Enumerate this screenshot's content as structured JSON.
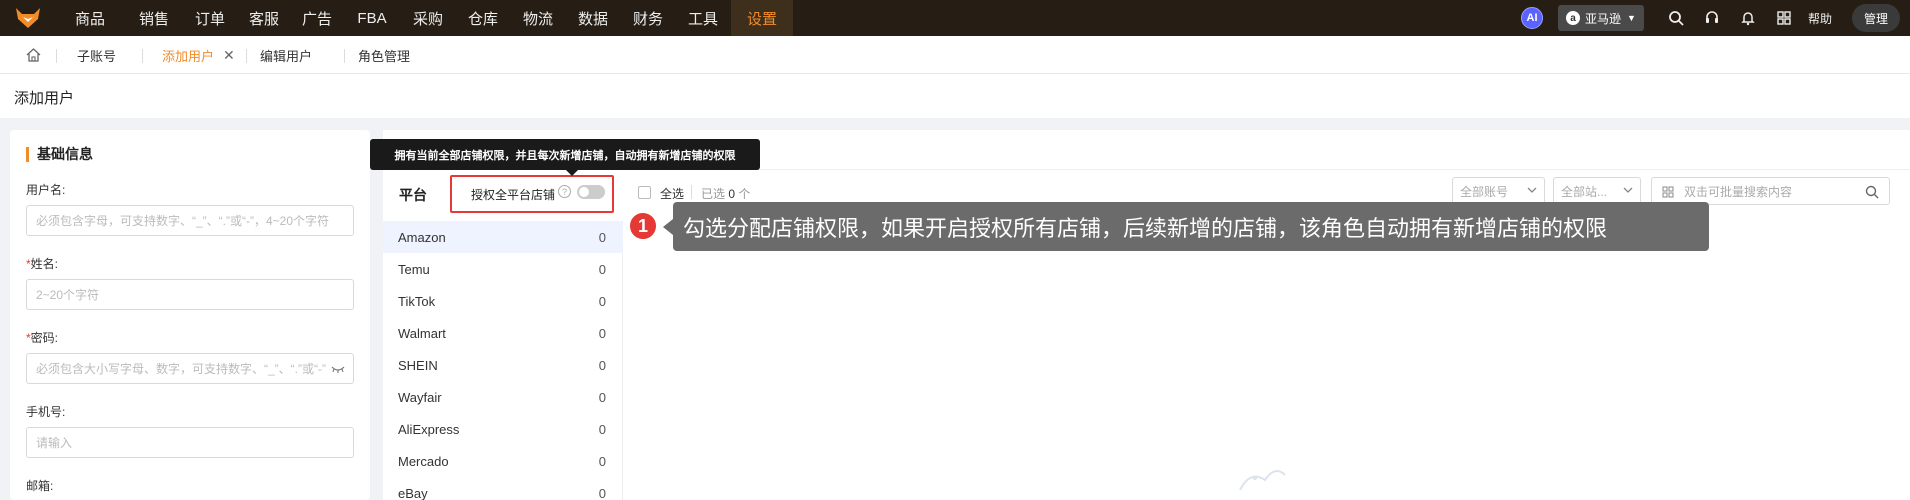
{
  "nav": {
    "items": [
      "商品",
      "销售",
      "订单",
      "客服",
      "广告",
      "FBA",
      "采购",
      "仓库",
      "物流",
      "数据",
      "财务",
      "工具",
      "设置"
    ],
    "active_index": 12
  },
  "topright": {
    "ai": "AI",
    "marketplace": "亚马逊",
    "help": "帮助",
    "user": "管理"
  },
  "tabs": [
    {
      "label": "子账号"
    },
    {
      "label": "添加用户",
      "active": true
    },
    {
      "label": "编辑用户"
    },
    {
      "label": "角色管理"
    }
  ],
  "page_title": "添加用户",
  "basic_info": {
    "title": "基础信息",
    "fields": [
      {
        "label": "用户名:",
        "required": false,
        "placeholder": "必须包含字母，可支持数字、“_”、“.”或“-”，4~20个字符"
      },
      {
        "label": "姓名:",
        "required": true,
        "placeholder": "2~20个字符"
      },
      {
        "label": "密码:",
        "required": true,
        "placeholder": "必须包含大小写字母、数字，可支持数字、“_”、“.”或“-”"
      },
      {
        "label": "手机号:",
        "required": false,
        "placeholder": "请输入"
      },
      {
        "label": "邮箱:",
        "required": false
      }
    ]
  },
  "store_auth": {
    "tooltip": "拥有当前全部店铺权限，并且每次新增店铺，自动拥有新增店铺的权限",
    "platform_header": "平台",
    "auth_all_label": "授权全平台店铺",
    "auth_all_enabled": false,
    "select_all": "全选",
    "selected_prefix": "已选",
    "selected_count": "0",
    "selected_suffix": "个",
    "account_filter": "全部账号",
    "site_filter": "全部站...",
    "search_placeholder": "双击可批量搜索内容",
    "platforms": [
      {
        "name": "Amazon",
        "count": "0"
      },
      {
        "name": "Temu",
        "count": "0"
      },
      {
        "name": "TikTok",
        "count": "0"
      },
      {
        "name": "Walmart",
        "count": "0"
      },
      {
        "name": "SHEIN",
        "count": "0"
      },
      {
        "name": "Wayfair",
        "count": "0"
      },
      {
        "name": "AliExpress",
        "count": "0"
      },
      {
        "name": "Mercado",
        "count": "0"
      },
      {
        "name": "eBay",
        "count": "0"
      }
    ]
  },
  "guide": {
    "step": "1",
    "text": "勾选分配店铺权限，如果开启授权所有店铺，后续新增的店铺，该角色自动拥有新增店铺的权限"
  },
  "colors": {
    "accent": "#f28c28",
    "topbar": "#261e14",
    "highlight": "#e53935"
  }
}
